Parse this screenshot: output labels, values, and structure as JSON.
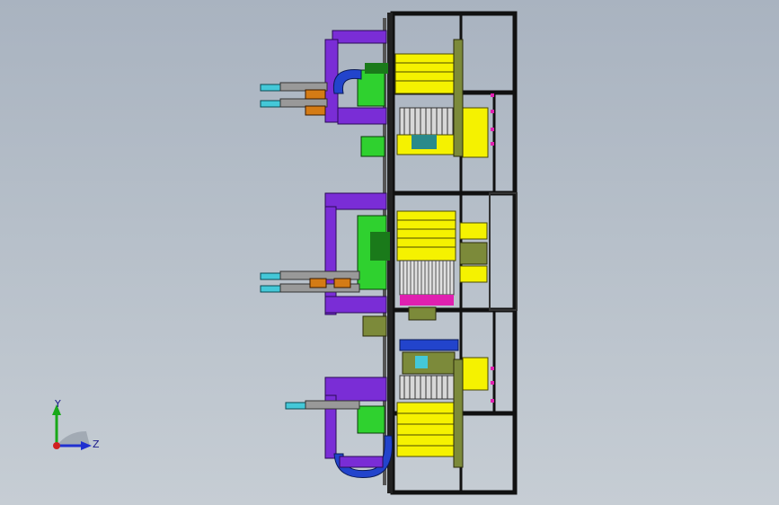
{
  "view": {
    "background_top": "#a9b3c0",
    "background_bottom": "#c6cdd4"
  },
  "model": {
    "frame_color": "#111111",
    "purple": "#7a2dd6",
    "yellow": "#f5f200",
    "green": "#2fd12f",
    "blue": "#2244cc",
    "cyan": "#44c8d8",
    "orange": "#d47b15",
    "magenta": "#e020b0",
    "olive": "#7c8a3a"
  },
  "triad": {
    "y_label": "Y",
    "z_label": "Z",
    "y_color": "#18a818",
    "z_color": "#2030d0",
    "x_color": "#d02020"
  }
}
